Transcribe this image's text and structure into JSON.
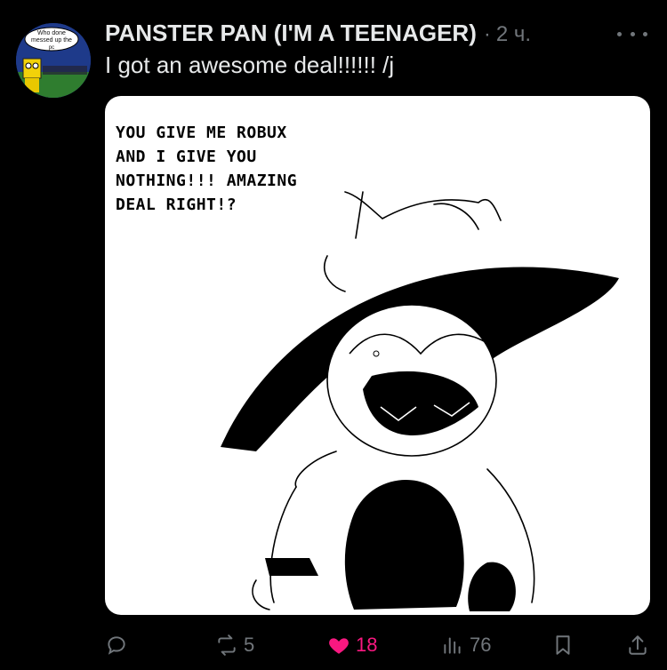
{
  "post": {
    "author_name": "PANSTER PAN (I'M A TEENAGER)",
    "separator": "·",
    "time": "2 ч.",
    "text": "I got an awesome deal!!!!!! /j"
  },
  "avatar": {
    "meme_text": "Who done messed up the pc 😭😭"
  },
  "media": {
    "caption": "YOU GIVE ME ROBUX\nAND I GIVE YOU\nNOTHING!!! AMAZING\nDEAL RIGHT!?"
  },
  "actions": {
    "reply": {
      "icon": "reply-icon",
      "count": ""
    },
    "repost": {
      "icon": "repost-icon",
      "count": "5"
    },
    "like": {
      "icon": "heart-icon",
      "count": "18",
      "liked": true,
      "color": "#f91880"
    },
    "views": {
      "icon": "views-icon",
      "count": "76"
    },
    "bookmark": {
      "icon": "bookmark-icon"
    },
    "share": {
      "icon": "share-icon"
    }
  },
  "colors": {
    "background": "#000000",
    "text_primary": "#e7e9ea",
    "text_secondary": "#71767b",
    "like": "#f91880"
  }
}
